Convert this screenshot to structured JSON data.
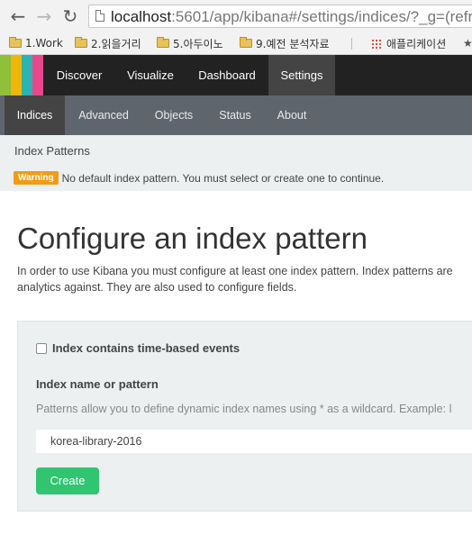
{
  "browser": {
    "url_host": "localhost",
    "url_rest": ":5601/app/kibana#/settings/indices/?_g=(refre",
    "bookmarks": [
      {
        "label": "1.Work"
      },
      {
        "label": "2.읽을거리"
      },
      {
        "label": "5.아두이노"
      },
      {
        "label": "9.예전 분석자료"
      },
      {
        "label": "애플리케이션"
      }
    ]
  },
  "topnav": {
    "logo_colors": [
      "#90bf3a",
      "#f0b70a",
      "#2cb3b0",
      "#e8488b"
    ],
    "tabs": [
      {
        "label": "Discover"
      },
      {
        "label": "Visualize"
      },
      {
        "label": "Dashboard"
      },
      {
        "label": "Settings",
        "active": true
      }
    ]
  },
  "subnav": {
    "tabs": [
      {
        "label": "Indices",
        "active": true
      },
      {
        "label": "Advanced"
      },
      {
        "label": "Objects"
      },
      {
        "label": "Status"
      },
      {
        "label": "About"
      }
    ]
  },
  "header": {
    "breadcrumb": "Index Patterns",
    "warning_badge": "Warning",
    "warning_text": "No default index pattern. You must select or create one to continue."
  },
  "main": {
    "title": "Configure an index pattern",
    "intro_line1": "In order to use Kibana you must configure at least one index pattern. Index patterns are",
    "intro_line2": "analytics against. They are also used to configure fields.",
    "form": {
      "checkbox_label": "Index contains time-based events",
      "checkbox_checked": false,
      "field_label": "Index name or pattern",
      "help_text": "Patterns allow you to define dynamic index names using * as a wildcard. Example: l",
      "input_value": "korea-library-2016",
      "create_label": "Create"
    }
  },
  "colors": {
    "topnav_bg": "#222222",
    "subnav_bg": "#5e656d",
    "panel_bg": "#ecf0f1",
    "warning": "#f39c12",
    "create": "#31c471"
  }
}
